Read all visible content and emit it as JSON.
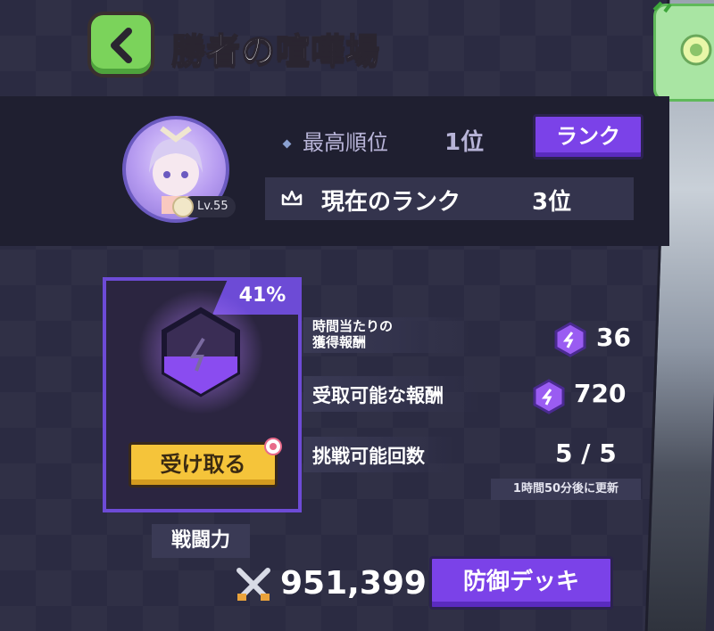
{
  "header": {
    "title": "勝者の喧嘩場"
  },
  "profile": {
    "level": "Lv.55"
  },
  "best_rank": {
    "label": "最高順位",
    "value": "1位"
  },
  "rank_button": {
    "label": "ランク"
  },
  "current_rank": {
    "label": "現在のランク",
    "value": "3位"
  },
  "reward": {
    "percent": "41%",
    "claim_label": "受け取る"
  },
  "stats": {
    "hourly": {
      "label_line1": "時間当たりの",
      "label_line2": "獲得報酬",
      "value": "36"
    },
    "claimable": {
      "label": "受取可能な報酬",
      "value": "720"
    },
    "attempts": {
      "label": "挑戦可能回数",
      "value": "5 / 5",
      "note": "1時間50分後に更新"
    }
  },
  "power": {
    "label": "戦闘力",
    "value": "951,399"
  },
  "defense_button": {
    "label": "防御デッキ"
  },
  "colors": {
    "accent": "#7b42e8",
    "gold": "#f5c43a",
    "green": "#7bd35b"
  }
}
